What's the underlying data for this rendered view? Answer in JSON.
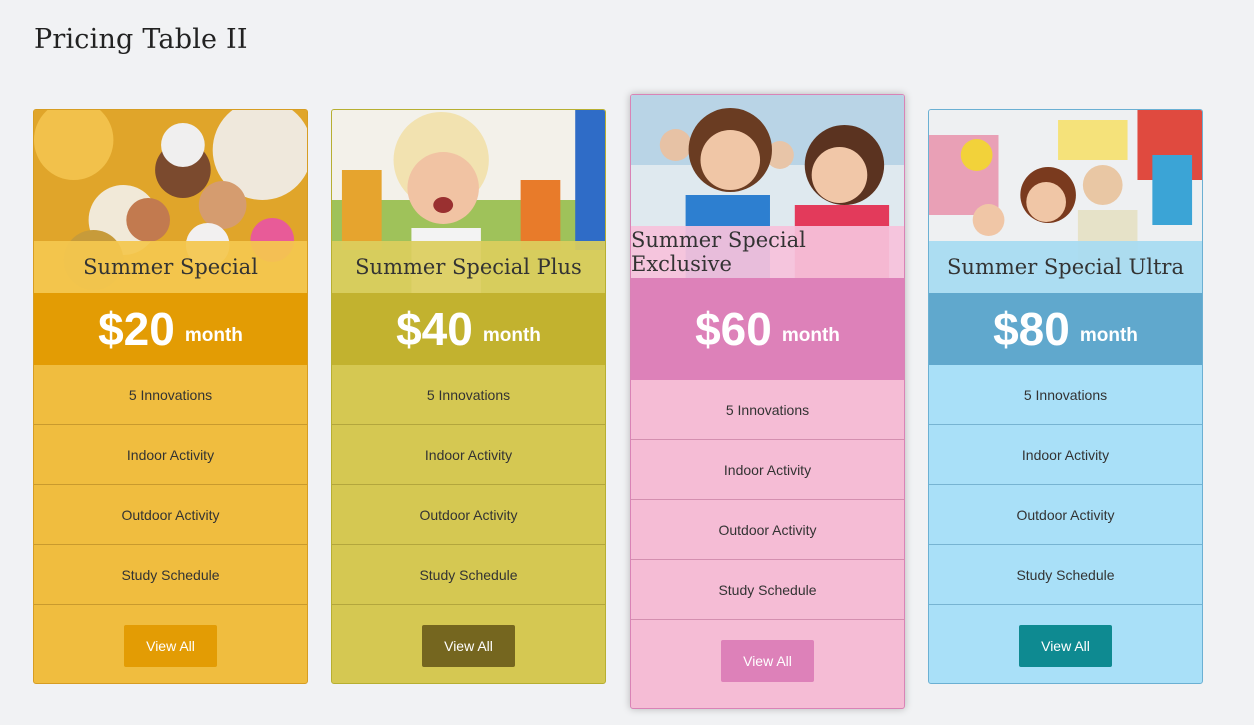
{
  "page": {
    "title": "Pricing Table II"
  },
  "plans": [
    {
      "name": "Summer Special",
      "price": "$20",
      "period": "month",
      "features": [
        "5 Innovations",
        "Indoor Activity",
        "Outdoor Activity",
        "Study Schedule"
      ],
      "button_label": "View All",
      "accent": "#e39c04"
    },
    {
      "name": "Summer Special Plus",
      "price": "$40",
      "period": "month",
      "features": [
        "5 Innovations",
        "Indoor Activity",
        "Outdoor Activity",
        "Study Schedule"
      ],
      "button_label": "View All",
      "accent": "#c2b22f"
    },
    {
      "name": "Summer Special Exclusive",
      "price": "$60",
      "period": "month",
      "features": [
        "5 Innovations",
        "Indoor Activity",
        "Outdoor Activity",
        "Study Schedule"
      ],
      "button_label": "View All",
      "accent": "#dd81b9"
    },
    {
      "name": "Summer Special Ultra",
      "price": "$80",
      "period": "month",
      "features": [
        "5 Innovations",
        "Indoor Activity",
        "Outdoor Activity",
        "Study Schedule"
      ],
      "button_label": "View All",
      "accent": "#60a8cd"
    }
  ]
}
